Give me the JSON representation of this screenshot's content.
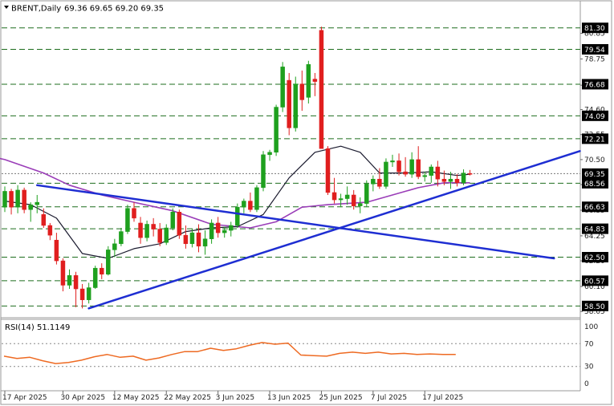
{
  "header": {
    "symbol": "BRENT,Daily",
    "ohlc": "69.36 69.65 69.20 69.35"
  },
  "colors": {
    "bull": "#1ea01e",
    "bear": "#e01e1e",
    "level": "#1e6e1e",
    "trendline": "#1e2ed2",
    "ma_fast": "#1a1a2e",
    "ma_slow": "#9a3db8",
    "rsi": "#ee6a22",
    "flag": "#000000"
  },
  "chart_data": [
    {
      "type": "candlestick",
      "title": "BRENT,Daily",
      "ylim": [
        57.6,
        82.4
      ],
      "yticks": [
        "80.85",
        "78.75",
        "76.60",
        "74.60",
        "72.55",
        "70.50",
        "68.45",
        "66.35",
        "64.25",
        "62.20",
        "60.10",
        "58.05"
      ],
      "y_tick_values": [
        80.85,
        78.75,
        76.6,
        74.6,
        72.55,
        70.5,
        68.45,
        66.35,
        64.25,
        62.2,
        60.1,
        58.05
      ],
      "levels": [
        81.3,
        79.54,
        76.68,
        74.09,
        72.21,
        68.56,
        66.63,
        64.83,
        62.5,
        60.57,
        58.5
      ],
      "level_labels": [
        "81.30",
        "79.54",
        "76.68",
        "74.09",
        "72.21",
        "68.56",
        "66.63",
        "64.83",
        "62.50",
        "60.57",
        "58.50"
      ],
      "current_price": 69.35,
      "current_price_label": "69.35",
      "x_labels": [
        "17 Apr 2025",
        "30 Apr 2025",
        "12 May 2025",
        "22 May 2025",
        "3 Jun 2025",
        "13 Jun 2025",
        "25 Jun 2025",
        "7 Jul 2025",
        "17 Jul 2025"
      ],
      "x_label_index": [
        0,
        9,
        17,
        25,
        33,
        41,
        49,
        57,
        65
      ],
      "candles": [
        [
          66.6,
          68.3,
          66.2,
          67.9
        ],
        [
          67.9,
          68.1,
          66.0,
          66.6
        ],
        [
          66.6,
          68.4,
          66.1,
          68.0
        ],
        [
          68.0,
          68.2,
          66.1,
          66.4
        ],
        [
          66.4,
          67.0,
          65.4,
          66.8
        ],
        [
          66.8,
          67.6,
          66.1,
          67.0
        ],
        [
          66.0,
          66.5,
          64.9,
          65.1
        ],
        [
          65.1,
          65.3,
          63.9,
          64.3
        ],
        [
          63.9,
          64.5,
          61.9,
          62.2
        ],
        [
          62.2,
          62.4,
          59.7,
          60.2
        ],
        [
          60.2,
          61.5,
          59.9,
          61.0
        ],
        [
          61.0,
          61.3,
          58.4,
          59.9
        ],
        [
          59.9,
          60.3,
          58.3,
          59.0
        ],
        [
          59.0,
          60.4,
          58.7,
          60.0
        ],
        [
          60.0,
          61.8,
          59.9,
          61.6
        ],
        [
          61.6,
          62.0,
          60.7,
          61.1
        ],
        [
          61.1,
          63.4,
          61.0,
          63.1
        ],
        [
          63.1,
          64.0,
          62.5,
          63.6
        ],
        [
          63.6,
          64.9,
          63.4,
          64.6
        ],
        [
          64.6,
          66.8,
          64.4,
          66.5
        ],
        [
          66.5,
          67.0,
          65.4,
          65.7
        ],
        [
          65.3,
          65.8,
          63.6,
          64.1
        ],
        [
          64.1,
          65.5,
          63.8,
          65.2
        ],
        [
          65.2,
          65.7,
          64.2,
          64.8
        ],
        [
          64.8,
          65.3,
          63.4,
          63.7
        ],
        [
          63.7,
          65.2,
          63.5,
          64.9
        ],
        [
          64.9,
          66.5,
          64.7,
          66.2
        ],
        [
          66.2,
          66.4,
          64.0,
          64.3
        ],
        [
          64.3,
          65.1,
          63.2,
          63.6
        ],
        [
          63.6,
          64.8,
          63.3,
          64.5
        ],
        [
          64.5,
          65.2,
          62.9,
          63.4
        ],
        [
          63.4,
          64.7,
          62.7,
          64.0
        ],
        [
          64.0,
          65.6,
          63.6,
          65.3
        ],
        [
          65.3,
          65.8,
          64.1,
          64.5
        ],
        [
          64.5,
          65.0,
          64.1,
          64.7
        ],
        [
          64.7,
          65.4,
          64.2,
          65.1
        ],
        [
          65.1,
          66.9,
          64.9,
          66.6
        ],
        [
          66.6,
          67.3,
          66.1,
          67.1
        ],
        [
          67.1,
          67.8,
          66.2,
          66.4
        ],
        [
          66.4,
          68.4,
          66.2,
          68.2
        ],
        [
          68.2,
          71.2,
          67.9,
          70.9
        ],
        [
          70.9,
          71.3,
          70.4,
          71.1
        ],
        [
          71.1,
          75.0,
          70.8,
          74.8
        ],
        [
          74.8,
          78.5,
          74.4,
          78.1
        ],
        [
          77.0,
          77.6,
          72.5,
          73.1
        ],
        [
          73.1,
          77.3,
          72.8,
          76.7
        ],
        [
          76.7,
          77.8,
          74.5,
          75.4
        ],
        [
          75.6,
          78.6,
          75.1,
          78.3
        ],
        [
          77.1,
          77.6,
          75.7,
          76.9
        ],
        [
          81.1,
          81.4,
          71.8,
          71.4
        ],
        [
          71.4,
          71.6,
          67.6,
          67.8
        ],
        [
          67.8,
          69.0,
          66.9,
          67.2
        ],
        [
          67.2,
          67.7,
          66.6,
          67.3
        ],
        [
          67.3,
          68.3,
          66.8,
          67.6
        ],
        [
          67.6,
          68.0,
          66.4,
          66.7
        ],
        [
          66.7,
          67.4,
          66.1,
          66.9
        ],
        [
          66.9,
          68.8,
          66.6,
          68.5
        ],
        [
          68.5,
          69.2,
          67.9,
          68.9
        ],
        [
          68.9,
          69.8,
          68.1,
          68.3
        ],
        [
          68.3,
          70.6,
          68.1,
          70.3
        ],
        [
          70.3,
          70.9,
          69.9,
          70.4
        ],
        [
          70.4,
          71.0,
          69.2,
          69.5
        ],
        [
          69.5,
          70.7,
          69.1,
          69.3
        ],
        [
          69.3,
          71.1,
          69.0,
          70.5
        ],
        [
          70.5,
          71.6,
          68.9,
          69.1
        ],
        [
          69.1,
          69.5,
          68.7,
          69.2
        ],
        [
          69.2,
          70.1,
          68.6,
          69.9
        ],
        [
          69.9,
          70.4,
          68.3,
          68.9
        ],
        [
          68.9,
          69.6,
          68.4,
          68.7
        ],
        [
          68.7,
          69.5,
          68.1,
          68.9
        ],
        [
          68.9,
          69.3,
          68.3,
          68.6
        ],
        [
          68.6,
          69.7,
          68.4,
          69.4
        ],
        [
          69.36,
          69.65,
          69.2,
          69.35
        ]
      ],
      "trendlines": [
        {
          "i0": 5,
          "v0": 68.4,
          "i1": 85,
          "v1": 62.4
        },
        {
          "i0": 13,
          "v0": 58.3,
          "i1": 89,
          "v1": 71.2
        }
      ],
      "ma_fast": [
        [
          0,
          67.1
        ],
        [
          4,
          66.8
        ],
        [
          8,
          65.7
        ],
        [
          12,
          62.8
        ],
        [
          16,
          62.4
        ],
        [
          20,
          63.2
        ],
        [
          24,
          63.6
        ],
        [
          28,
          64.6
        ],
        [
          32,
          64.9
        ],
        [
          36,
          65.0
        ],
        [
          40,
          66.0
        ],
        [
          44,
          69.0
        ],
        [
          48,
          71.1
        ],
        [
          52,
          71.6
        ],
        [
          55,
          71.1
        ],
        [
          58,
          69.4
        ],
        [
          62,
          69.4
        ],
        [
          66,
          69.5
        ],
        [
          70,
          69.2
        ],
        [
          72,
          69.3
        ]
      ],
      "ma_slow": [
        [
          -5,
          71.1
        ],
        [
          0,
          70.5
        ],
        [
          6,
          69.4
        ],
        [
          10,
          68.4
        ],
        [
          15,
          67.6
        ],
        [
          20,
          67.0
        ],
        [
          26,
          66.3
        ],
        [
          32,
          65.2
        ],
        [
          38,
          64.9
        ],
        [
          42,
          65.4
        ],
        [
          46,
          66.6
        ],
        [
          50,
          66.8
        ],
        [
          56,
          67.0
        ],
        [
          60,
          67.6
        ],
        [
          64,
          68.2
        ],
        [
          68,
          68.6
        ],
        [
          72,
          68.6
        ]
      ]
    },
    {
      "type": "line",
      "title": "RSI(14) 51.1149",
      "ylim": [
        0,
        100
      ],
      "yticks": [
        "100",
        "70",
        "30",
        "0"
      ],
      "y_tick_values": [
        100,
        70,
        30,
        0
      ],
      "levels": [
        70,
        30
      ],
      "values": [
        [
          0,
          48
        ],
        [
          3,
          44
        ],
        [
          6,
          46
        ],
        [
          9,
          40
        ],
        [
          12,
          35
        ],
        [
          15,
          37
        ],
        [
          18,
          41
        ],
        [
          21,
          47
        ],
        [
          24,
          51
        ],
        [
          27,
          46
        ],
        [
          30,
          48
        ],
        [
          33,
          41
        ],
        [
          36,
          45
        ],
        [
          39,
          51
        ],
        [
          42,
          56
        ],
        [
          45,
          56
        ],
        [
          48,
          62
        ],
        [
          51,
          58
        ],
        [
          54,
          61
        ],
        [
          57,
          67
        ],
        [
          60,
          72
        ],
        [
          63,
          69
        ],
        [
          66,
          71
        ],
        [
          69,
          50
        ],
        [
          72,
          49
        ],
        [
          75,
          48
        ],
        [
          78,
          53
        ],
        [
          81,
          55
        ],
        [
          84,
          53
        ],
        [
          87,
          55
        ],
        [
          90,
          52
        ],
        [
          93,
          53
        ],
        [
          96,
          51
        ],
        [
          99,
          52
        ],
        [
          102,
          51
        ],
        [
          105,
          51.1
        ]
      ]
    }
  ]
}
